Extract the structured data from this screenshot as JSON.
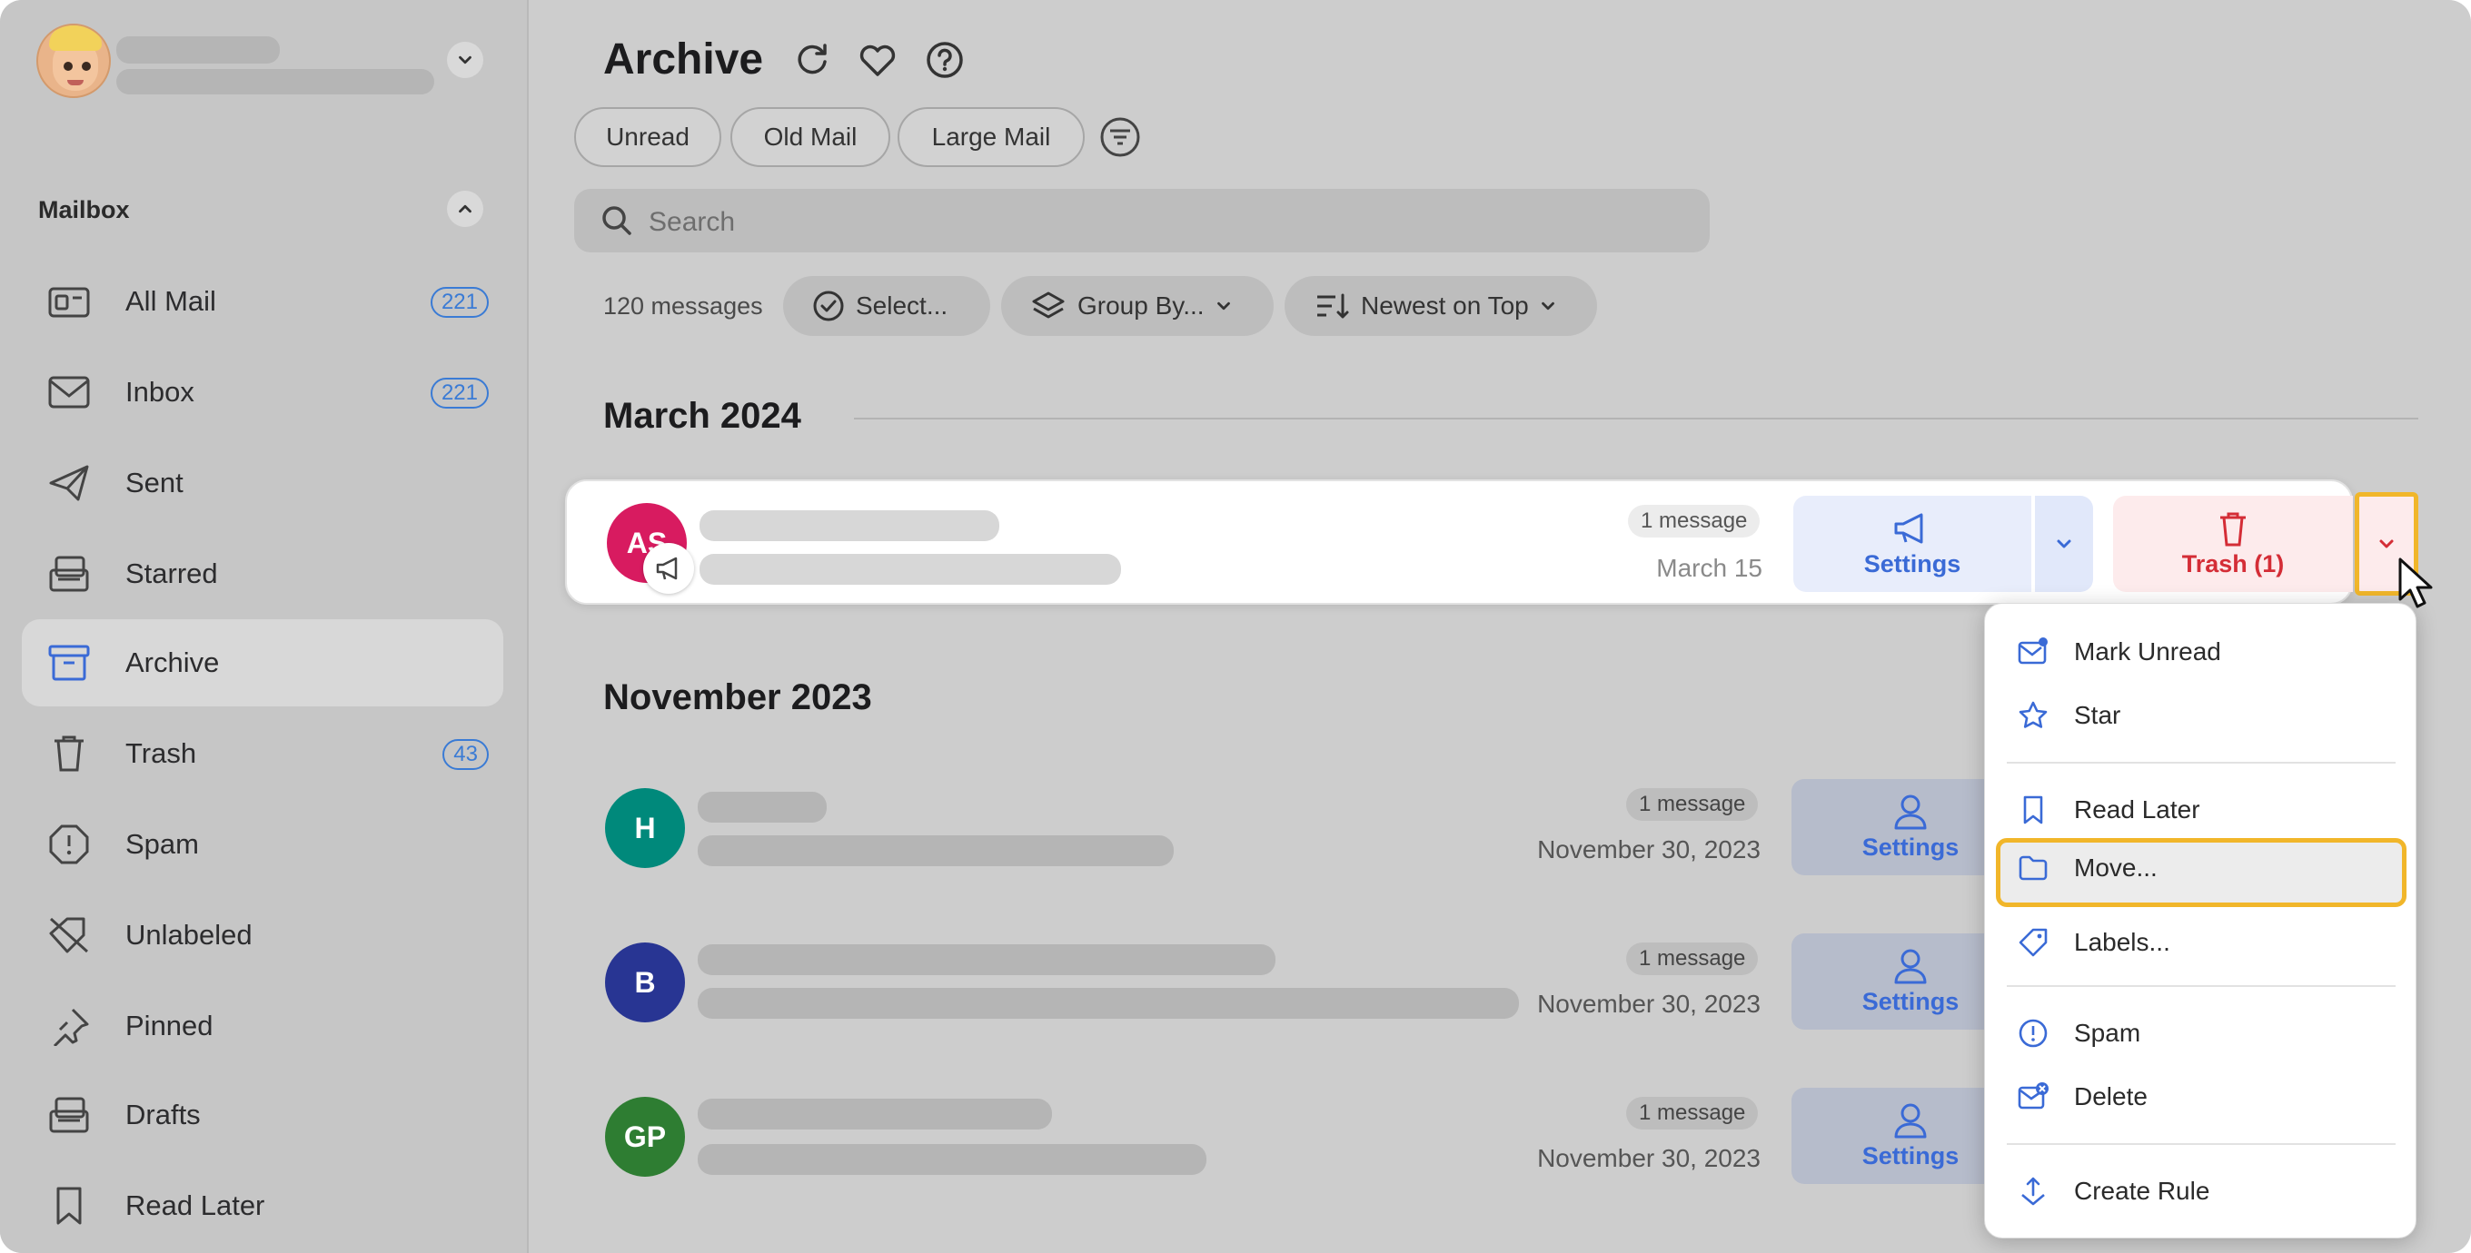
{
  "sidebar": {
    "section_title": "Mailbox",
    "items": [
      {
        "label": "All Mail",
        "badge": "221",
        "icon": "all-mail-icon"
      },
      {
        "label": "Inbox",
        "badge": "221",
        "icon": "inbox-icon"
      },
      {
        "label": "Sent",
        "badge": "",
        "icon": "sent-icon"
      },
      {
        "label": "Starred",
        "badge": "",
        "icon": "starred-icon"
      },
      {
        "label": "Archive",
        "badge": "",
        "icon": "archive-icon"
      },
      {
        "label": "Trash",
        "badge": "43",
        "icon": "trash-icon"
      },
      {
        "label": "Spam",
        "badge": "",
        "icon": "spam-icon"
      },
      {
        "label": "Unlabeled",
        "badge": "",
        "icon": "unlabeled-icon"
      },
      {
        "label": "Pinned",
        "badge": "",
        "icon": "pin-icon"
      },
      {
        "label": "Drafts",
        "badge": "",
        "icon": "drafts-icon"
      },
      {
        "label": "Read Later",
        "badge": "",
        "icon": "bookmark-icon"
      }
    ],
    "active": "Archive"
  },
  "header": {
    "title": "Archive",
    "chips": [
      "Unread",
      "Old Mail",
      "Large Mail"
    ]
  },
  "search": {
    "placeholder": "Search"
  },
  "toolbar": {
    "message_count": "120 messages",
    "select_label": "Select...",
    "group_by_label": "Group By...",
    "sort_label": "Newest on Top"
  },
  "groups": [
    {
      "title": "March 2024",
      "rows": [
        {
          "initials": "AS",
          "color": "#d81b60",
          "count": "1 message",
          "date": "March 15",
          "action_label": "Settings",
          "trash_label": "Trash (1)"
        }
      ]
    },
    {
      "title": "November 2023",
      "rows": [
        {
          "initials": "H",
          "color": "#00897b",
          "count": "1 message",
          "date": "November 30, 2023",
          "action_label": "Settings"
        },
        {
          "initials": "B",
          "color": "#283593",
          "count": "1 message",
          "date": "November 30, 2023",
          "action_label": "Settings"
        },
        {
          "initials": "GP",
          "color": "#2e7d32",
          "count": "1 message",
          "date": "November 30, 2023",
          "action_label": "Settings"
        }
      ]
    }
  ],
  "menu": {
    "items": [
      {
        "label": "Mark Unread",
        "icon": "mark-unread-icon"
      },
      {
        "label": "Star",
        "icon": "star-icon"
      },
      {
        "label": "Read Later",
        "icon": "bookmark-icon"
      },
      {
        "label": "Move...",
        "icon": "folder-icon"
      },
      {
        "label": "Labels...",
        "icon": "label-icon"
      },
      {
        "label": "Spam",
        "icon": "spam-icon"
      },
      {
        "label": "Delete",
        "icon": "delete-mail-icon"
      },
      {
        "label": "Create Rule",
        "icon": "create-rule-icon"
      }
    ],
    "highlighted": "Move..."
  },
  "colors": {
    "accent": "#3a6ad6",
    "danger": "#d42d36",
    "highlight_outline": "#f1b62a",
    "badge_blue": "#3a7bd5"
  }
}
